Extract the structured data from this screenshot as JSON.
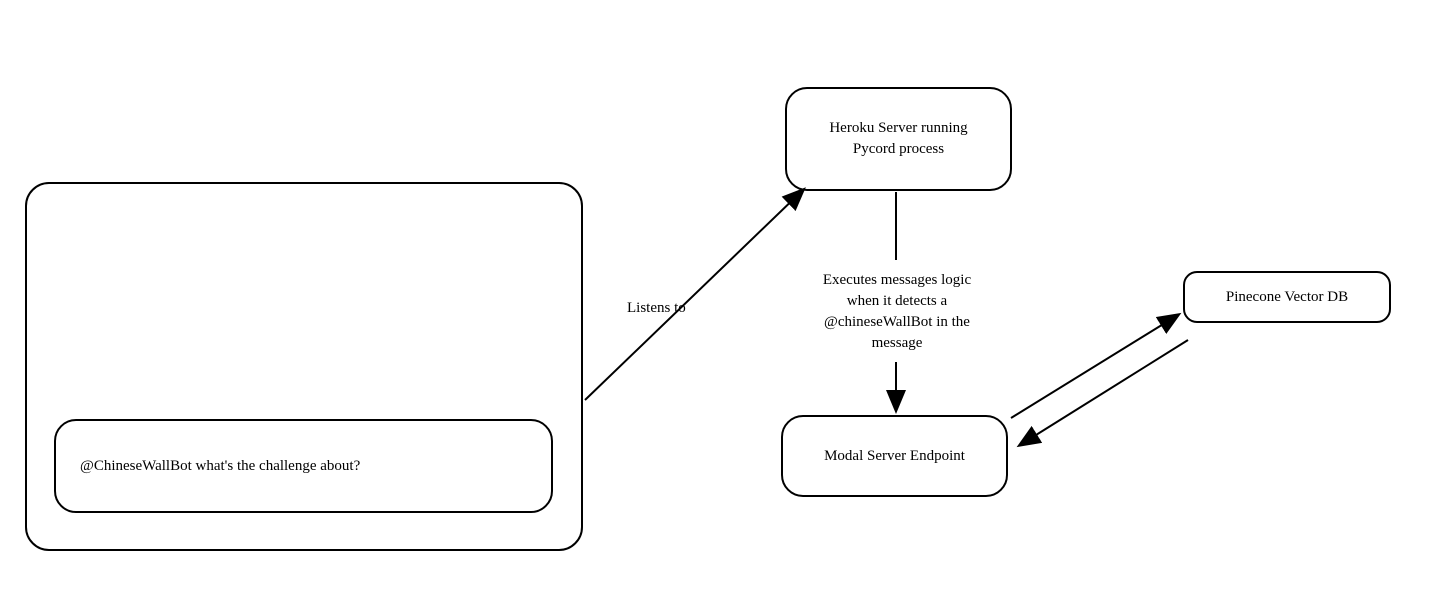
{
  "nodes": {
    "message": "@ChineseWallBot what's the challenge about?",
    "heroku": "Heroku Server running\nPycord process",
    "modal": "Modal Server Endpoint",
    "pinecone": "Pinecone Vector DB"
  },
  "labels": {
    "listens": "Listens to",
    "executes": "Executes messages logic when it detects a @chineseWallBot in the message"
  },
  "chart_data": {
    "type": "flow-diagram",
    "nodes": [
      {
        "id": "discord",
        "label": "",
        "description": "Discord-style chat container"
      },
      {
        "id": "message",
        "label": "@ChineseWallBot what's the challenge about?"
      },
      {
        "id": "heroku",
        "label": "Heroku Server running Pycord process"
      },
      {
        "id": "modal",
        "label": "Modal Server Endpoint"
      },
      {
        "id": "pinecone",
        "label": "Pinecone Vector DB"
      }
    ],
    "edges": [
      {
        "from": "discord",
        "to": "heroku",
        "label": "Listens to",
        "direction": "one-way"
      },
      {
        "from": "heroku",
        "to": "modal",
        "label": "Executes messages logic when it detects a @chineseWallBot in the message",
        "direction": "one-way"
      },
      {
        "from": "modal",
        "to": "pinecone",
        "label": "",
        "direction": "bidirectional"
      }
    ]
  }
}
